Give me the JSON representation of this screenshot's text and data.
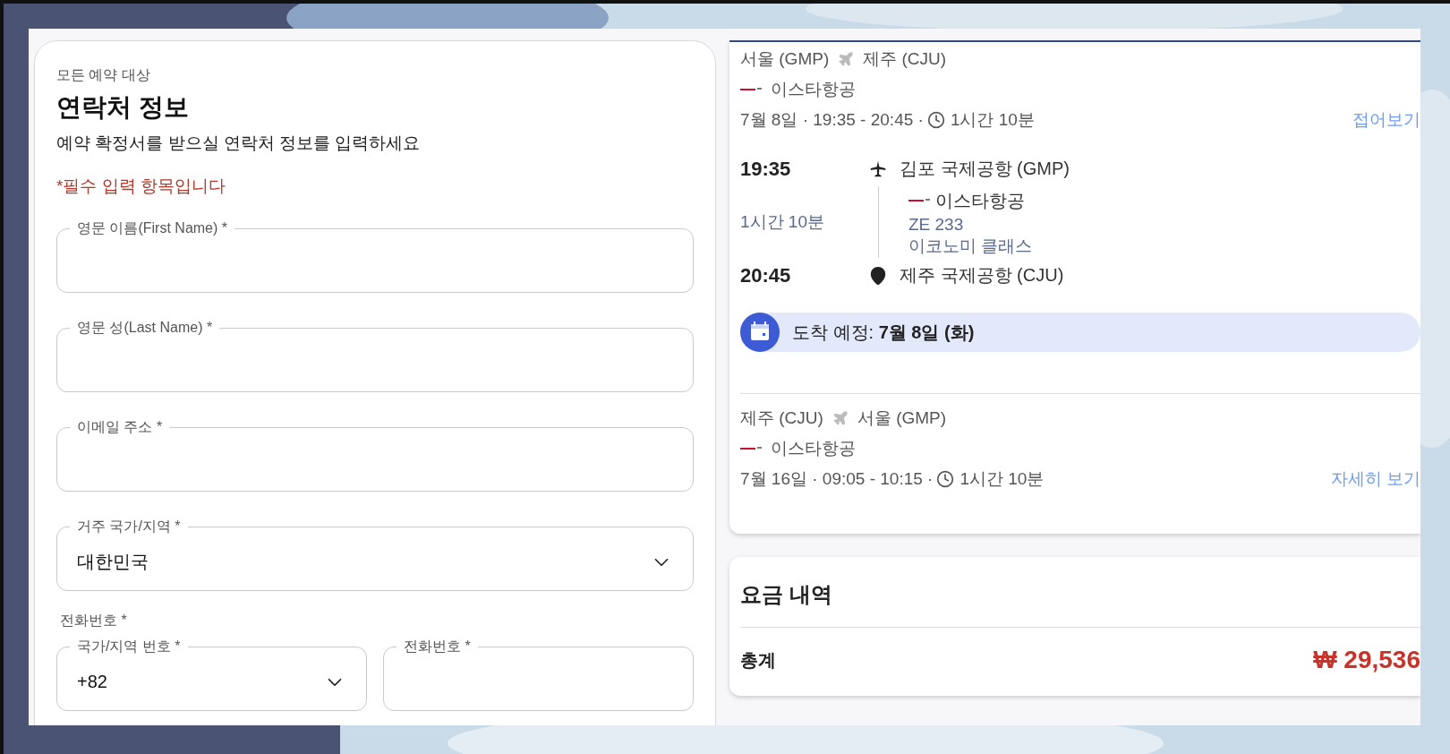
{
  "contact_form": {
    "eyebrow": "모든 예약 대상",
    "title": "연락처 정보",
    "subtitle": "예약 확정서를 받으실 연락처 정보를 입력하세요",
    "required_note": "*필수 입력 항목입니다",
    "fields": [
      {
        "kind": "text",
        "label": "영문 이름(First Name) *"
      },
      {
        "kind": "text",
        "label": "영문 성(Last Name) *"
      },
      {
        "kind": "text",
        "label": "이메일 주소 *"
      },
      {
        "kind": "select",
        "label": "거주 국가/지역 *",
        "value": "대한민국"
      }
    ],
    "phone": {
      "label": "전화번호 *",
      "fields": [
        {
          "kind": "select",
          "label": "국가/지역 번호 *",
          "value": "+82"
        },
        {
          "kind": "text",
          "label": "전화번호 *"
        }
      ]
    }
  },
  "flights": [
    {
      "from": "서울 (GMP)",
      "to": "제주 (CJU)",
      "airline": "이스타항공",
      "schedule": "7월 8일 · 19:35 - 20:45 ·",
      "duration": "1시간 10분",
      "toggle": "접어보기",
      "details": {
        "depart_time": "19:35",
        "depart_airport": "김포 국제공항 (GMP)",
        "flight_duration": "1시간 10분",
        "airline": "이스타항공",
        "flight_number": "ZE 233",
        "cabin": "이코노미 클래스",
        "arrive_time": "20:45",
        "arrive_airport": "제주 국제공항 (CJU)",
        "arrival_note": "도착 예정: **7월 8일 (화)**"
      }
    },
    {
      "from": "제주 (CJU)",
      "to": "서울 (GMP)",
      "airline": "이스타항공",
      "schedule": "7월 16일 · 09:05 - 10:15 ·",
      "duration": "1시간 10분",
      "toggle": "자세히 보기"
    }
  ],
  "price": {
    "title": "요금 내역",
    "total_label": "총계",
    "total": "₩ 29,536"
  }
}
